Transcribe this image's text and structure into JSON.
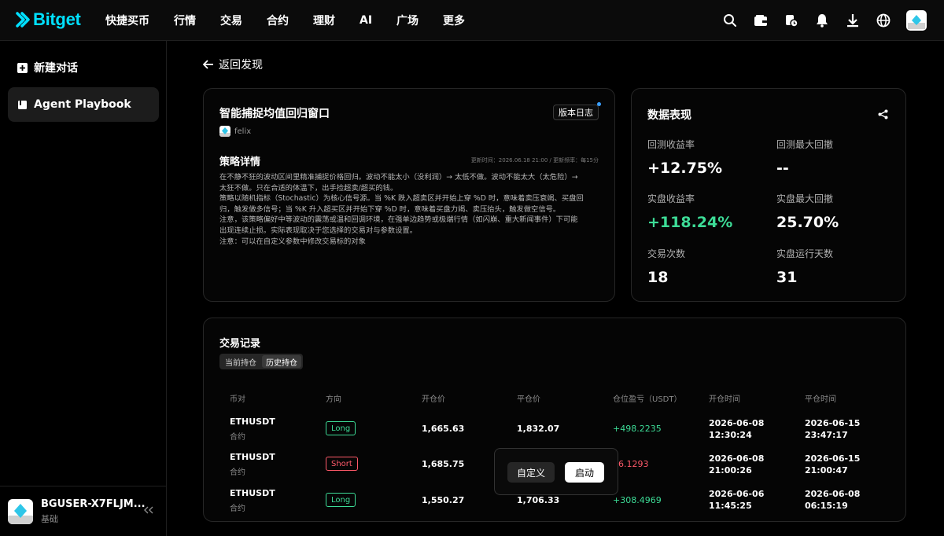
{
  "brand": {
    "name": "Bitget",
    "color": "#00e0ff"
  },
  "nav": [
    "快捷买币",
    "行情",
    "交易",
    "合约",
    "理财",
    "AI",
    "广场",
    "更多"
  ],
  "top_icons": [
    "search-icon",
    "wallet-icon",
    "history-icon",
    "bell-icon",
    "download-icon",
    "globe-icon",
    "avatar"
  ],
  "sidebar": {
    "items": [
      {
        "label": "新建对话",
        "icon": "plus-square-icon"
      },
      {
        "label": "Agent Playbook",
        "icon": "book-icon"
      }
    ],
    "user": {
      "name": "BGUSER-X7FLJM...",
      "tier": "基础"
    }
  },
  "back_label": "返回发现",
  "strategy": {
    "title": "智能捕捉均值回归窗口",
    "version_btn": "版本日志",
    "author": "felix",
    "detail_heading": "策略详情",
    "meta": "更新时间：2026.06.18 21:00 / 更新频率：每15分",
    "description": [
      "在不静不狂的波动区间里精准捕捉价格回归。波动不能太小（没利润）→ 太低不做。波动不能太大（太危险）→",
      "太狂不做。只在合适的体温下，出手捡超卖/超买的钱。",
      "策略以随机指标（Stochastic）为核心信号源。当 %K 跌入超卖区并开始上穿 %D 时，意味着卖压衰竭、买盘回",
      "归，触发做多信号；当 %K 升入超买区并开始下穿 %D 时，意味着买盘力竭、卖压抬头，触发做空信号。",
      "注意，该策略偏好中等波动的震荡或温和回调环境，在强单边趋势或极端行情（如闪崩、重大新闻事件）下可能",
      "出现连续止损。实际表现取决于您选择的交易对与参数设置。",
      "注意：可以在自定义参数中修改交易标的对象"
    ]
  },
  "performance": {
    "title": "数据表现",
    "stats": [
      {
        "label": "回测收益率",
        "value": "+12.75%"
      },
      {
        "label": "回测最大回撤",
        "value": "--"
      },
      {
        "label": "实盘收益率",
        "value": "+118.24%",
        "color": "#3ddc97"
      },
      {
        "label": "实盘最大回撤",
        "value": "25.70%"
      },
      {
        "label": "交易次数",
        "value": "18"
      },
      {
        "label": "实盘运行天数",
        "value": "31"
      }
    ]
  },
  "trades": {
    "title": "交易记录",
    "tabs": [
      "当前持仓",
      "历史持仓"
    ],
    "headers": [
      "币对",
      "方向",
      "开仓价",
      "平仓价",
      "仓位盈亏（USDT）",
      "开仓时间",
      "平仓时间"
    ],
    "rows": [
      {
        "symbol": "ETHUSDT",
        "type": "合约",
        "side": "Long",
        "open": "1,665.63",
        "close": "1,832.07",
        "pnl": "+498.2235",
        "open_date": "2026-06-08",
        "open_time": "12:30:24",
        "close_date": "2026-06-15",
        "close_time": "23:47:17"
      },
      {
        "symbol": "ETHUSDT",
        "type": "合约",
        "side": "Short",
        "open": "1,685.75",
        "close": "",
        "pnl": "96.1293",
        "open_date": "2026-06-08",
        "open_time": "21:00:26",
        "close_date": "2026-06-15",
        "close_time": "21:00:47"
      },
      {
        "symbol": "ETHUSDT",
        "type": "合约",
        "side": "Long",
        "open": "1,550.27",
        "close": "1,706.33",
        "pnl": "+308.4969",
        "open_date": "2026-06-06",
        "open_time": "11:45:25",
        "close_date": "2026-06-08",
        "close_time": "06:15:19"
      }
    ]
  },
  "popup": {
    "custom": "自定义",
    "start": "启动"
  }
}
